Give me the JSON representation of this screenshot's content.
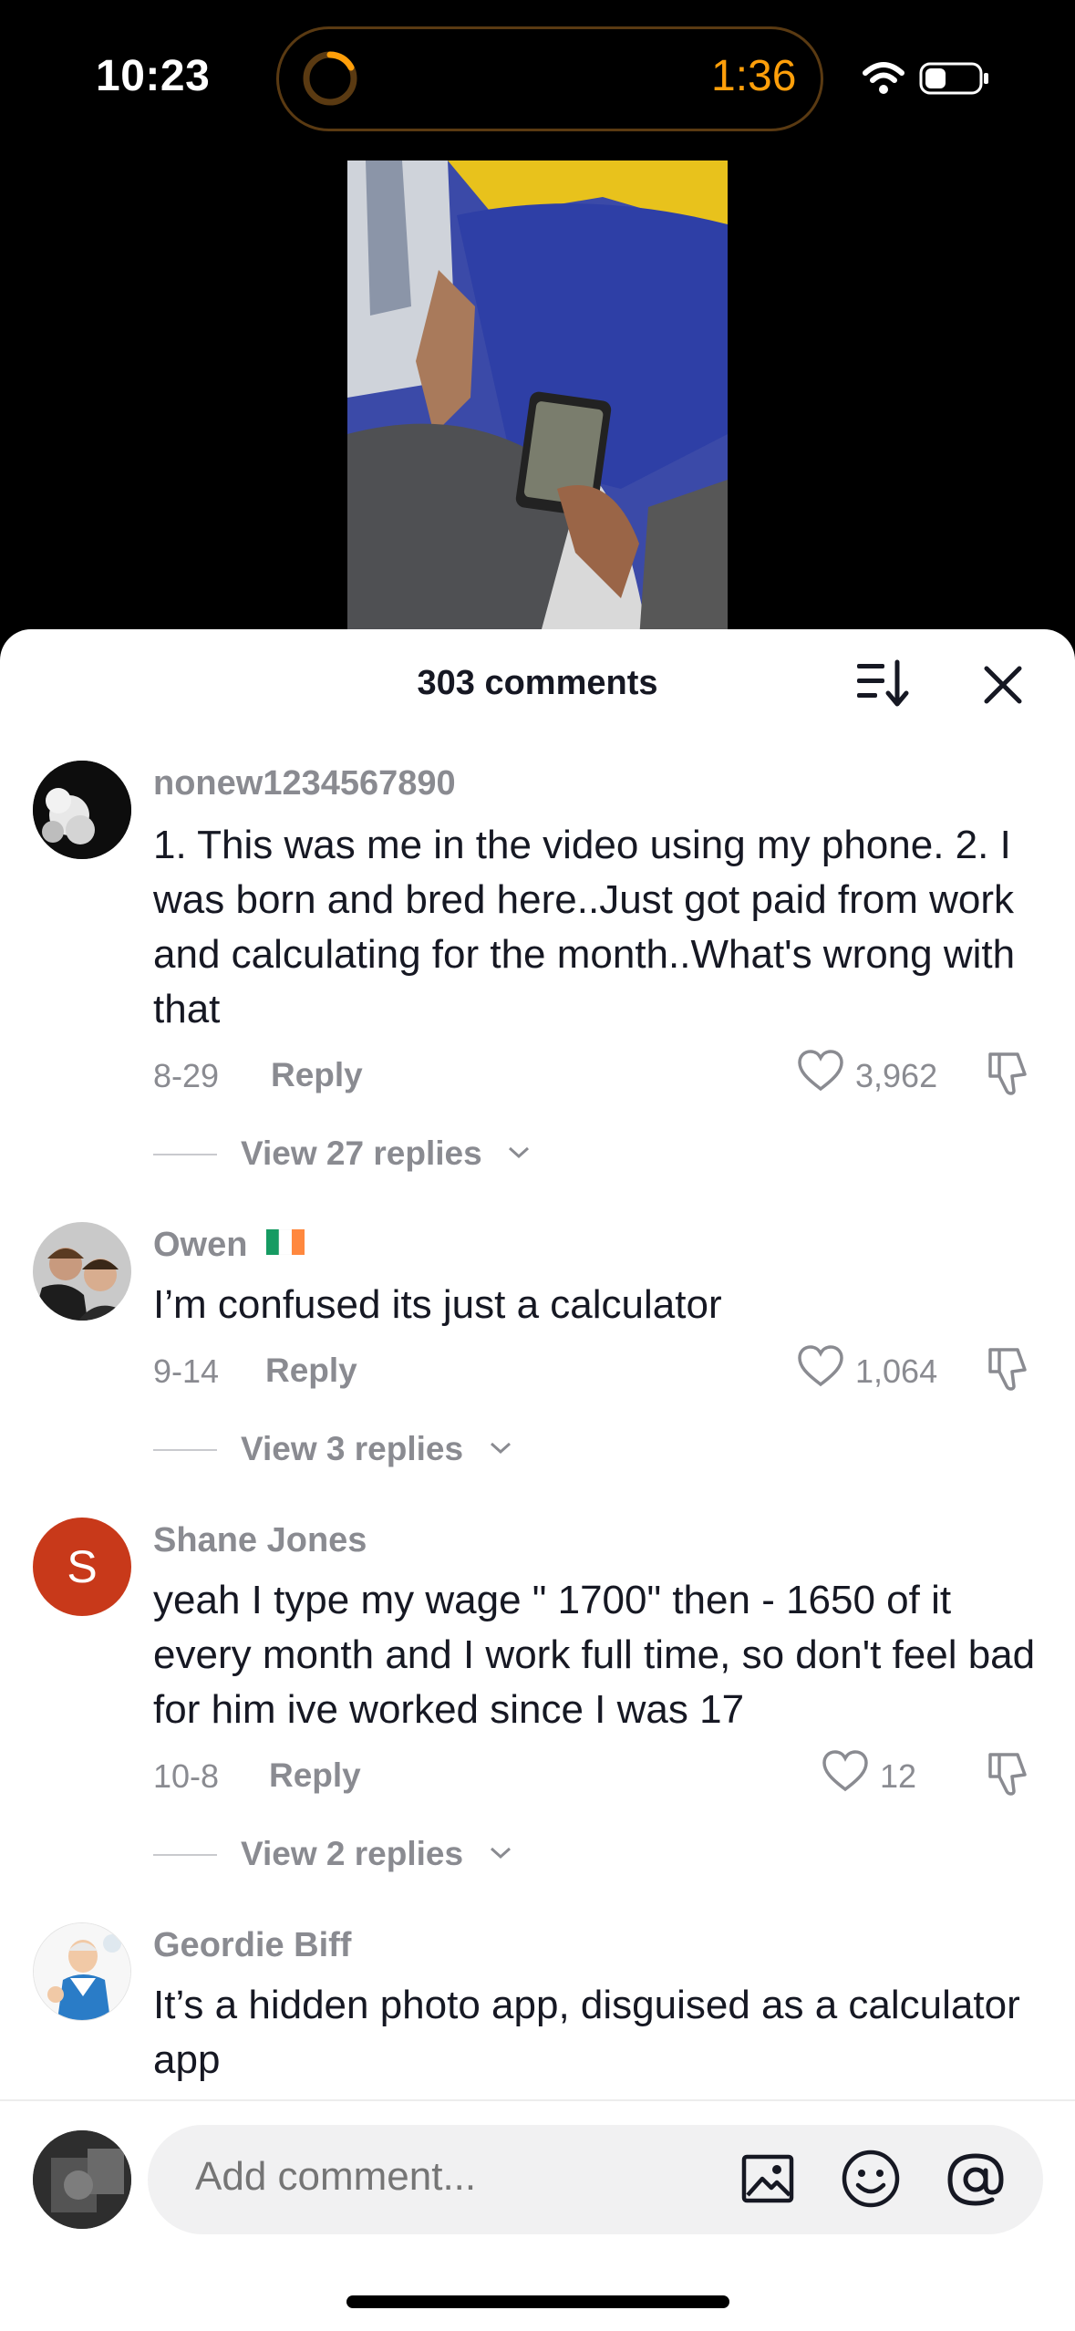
{
  "status_bar": {
    "time": "10:23",
    "timer": "1:36"
  },
  "comments_sheet": {
    "title": "303 comments",
    "comments": [
      {
        "username": "nonew1234567890",
        "text": "1. This was me in the video using my phone. 2. I was born and bred here..Just got paid from work and calculating for the month..What's wrong with that",
        "date": "8-29",
        "reply_label": "Reply",
        "likes": "3,962",
        "view_replies": "View 27 replies"
      },
      {
        "username": "Owen",
        "flag": "Ireland",
        "text": "I’m confused its just a calculator",
        "date": "9-14",
        "reply_label": "Reply",
        "likes": "1,064",
        "view_replies": "View 3 replies"
      },
      {
        "username": "Shane Jones",
        "avatar_initial": "S",
        "avatar_color": "#c8391a",
        "text": "yeah I type my wage \" 1700\" then - 1650 of it every month and I work full time, so don't feel bad for him ive worked since I was 17",
        "date": "10-8",
        "reply_label": "Reply",
        "likes": "12",
        "view_replies": "View 2 replies"
      },
      {
        "username": "Geordie Biff",
        "text": "It’s a hidden photo app, disguised as a calculator app"
      }
    ]
  },
  "composer": {
    "placeholder": "Add comment..."
  },
  "colors": {
    "accent_orange": "#ff9f0a",
    "muted_text": "#8a8b91",
    "primary_text": "#161823"
  }
}
